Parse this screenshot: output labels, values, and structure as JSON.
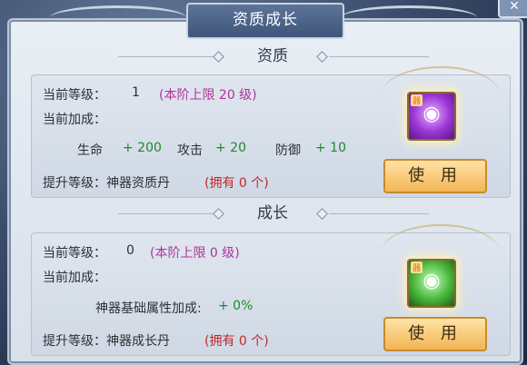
{
  "window": {
    "title": "资质成长",
    "close_icon": "close-icon"
  },
  "aptitude": {
    "header": "资质",
    "current_level_label": "当前等级：",
    "current_level_value": "1",
    "current_level_cap": "(本阶上限 20 级)",
    "current_bonus_label": "当前加成：",
    "stats": [
      {
        "label": "生命",
        "value": "+ 200"
      },
      {
        "label": "攻击",
        "value": "+ 20"
      },
      {
        "label": "防御",
        "value": "+ 10"
      }
    ],
    "upgrade_label": "提升等级：神器资质丹",
    "owned_text": "(拥有 0 个)",
    "item_tag": "器",
    "item_icon": "purple-orb-icon",
    "use_button": "使 用"
  },
  "growth": {
    "header": "成长",
    "current_level_label": "当前等级：",
    "current_level_value": "0",
    "current_level_cap": "(本阶上限 0 级)",
    "current_bonus_label": "当前加成：",
    "bonus_stat_label": "神器基础属性加成:",
    "bonus_stat_value": "+ 0%",
    "upgrade_label": "提升等级：神器成长丹",
    "owned_text": "(拥有 0 个)",
    "item_tag": "器",
    "item_icon": "green-orb-icon",
    "use_button": "使 用"
  },
  "colors": {
    "cap_text": "#b0329a",
    "owned_text": "#c0282a",
    "stat_value": "#1c8a2a",
    "use_button": "#f2b555"
  }
}
